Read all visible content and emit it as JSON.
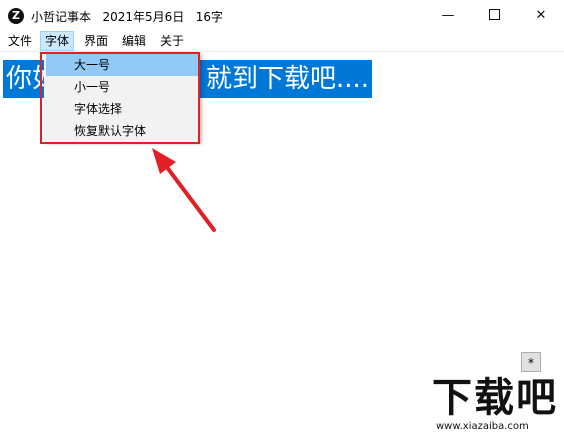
{
  "window": {
    "app_icon_letter": "Z",
    "title": "小哲记事本   2021年5月6日   16字",
    "minimize_glyph": "—",
    "close_glyph": "✕"
  },
  "menubar": {
    "items": [
      {
        "label": "文件"
      },
      {
        "label": "字体"
      },
      {
        "label": "界面"
      },
      {
        "label": "编辑"
      },
      {
        "label": "关于"
      }
    ]
  },
  "font_menu": {
    "items": [
      {
        "label": "大一号"
      },
      {
        "label": "小一号"
      },
      {
        "label": "字体选择"
      },
      {
        "label": "恢复默认字体"
      }
    ]
  },
  "editor": {
    "visible_left": "你如",
    "visible_right": "就到下载吧...."
  },
  "corner_button": {
    "label": "*"
  },
  "watermark": {
    "logo": "下载吧",
    "url": "www.xiazaiba.com"
  },
  "colors": {
    "selection": "#0078d7",
    "highlight_box": "#e01f26",
    "menu_hover": "#91c9f7"
  }
}
